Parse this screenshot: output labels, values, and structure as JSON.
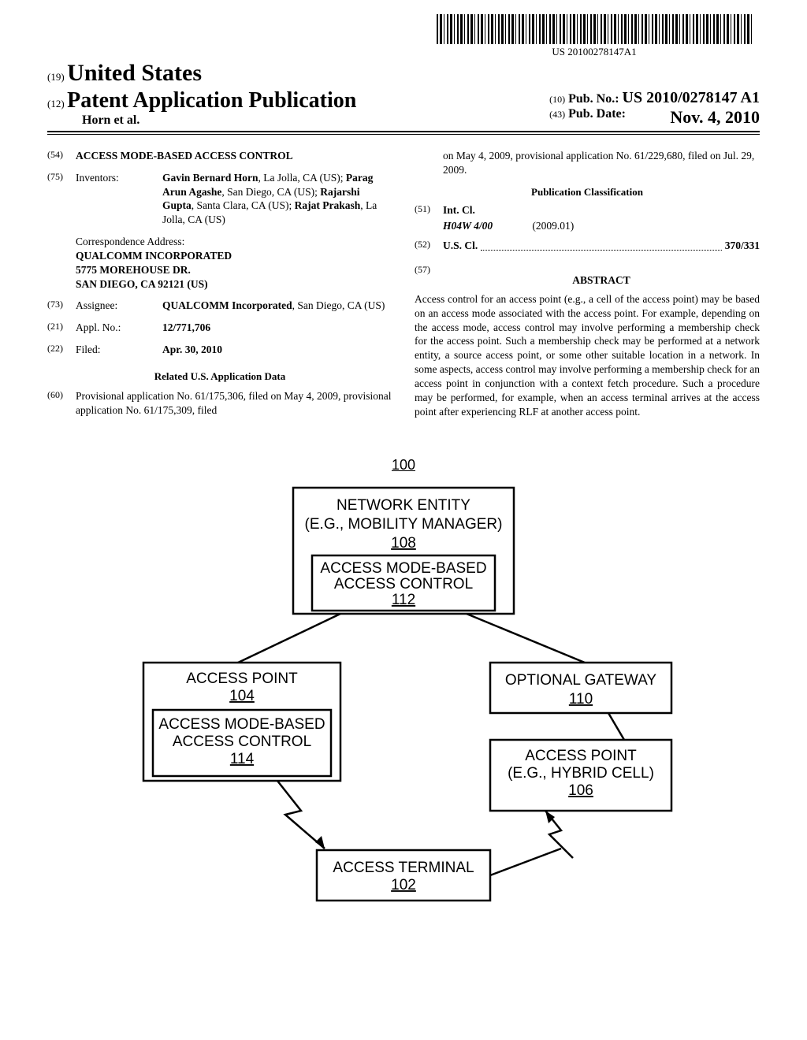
{
  "barcode_text": "US 20100278147A1",
  "country_code": "(19)",
  "country": "United States",
  "doc_type_code": "(12)",
  "doc_type": "Patent Application Publication",
  "authors_line": "Horn et al.",
  "pub_no_code": "(10)",
  "pub_no_label": "Pub. No.:",
  "pub_no": "US 2010/0278147 A1",
  "pub_date_code": "(43)",
  "pub_date_label": "Pub. Date:",
  "pub_date": "Nov. 4, 2010",
  "left": {
    "title_code": "(54)",
    "title": "ACCESS MODE-BASED ACCESS CONTROL",
    "inventors_code": "(75)",
    "inventors_label": "Inventors:",
    "inventors": "Gavin Bernard Horn, La Jolla, CA (US); Parag Arun Agashe, San Diego, CA (US); Rajarshi Gupta, Santa Clara, CA (US); Rajat Prakash, La Jolla, CA (US)",
    "correspondence_label": "Correspondence Address:",
    "correspondence": "QUALCOMM INCORPORATED\n5775 MOREHOUSE DR.\nSAN DIEGO, CA 92121 (US)",
    "assignee_code": "(73)",
    "assignee_label": "Assignee:",
    "assignee": "QUALCOMM Incorporated, San Diego, CA (US)",
    "applno_code": "(21)",
    "applno_label": "Appl. No.:",
    "applno": "12/771,706",
    "filed_code": "(22)",
    "filed_label": "Filed:",
    "filed": "Apr. 30, 2010",
    "related_head": "Related U.S. Application Data",
    "prov_code": "(60)",
    "prov": "Provisional application No. 61/175,306, filed on May 4, 2009, provisional application No. 61/175,309, filed"
  },
  "right": {
    "prov_cont": "on May 4, 2009, provisional application No. 61/229,680, filed on Jul. 29, 2009.",
    "class_head": "Publication Classification",
    "intcl_code": "(51)",
    "intcl_label": "Int. Cl.",
    "intcl_class": "H04W 4/00",
    "intcl_date": "(2009.01)",
    "uscl_code": "(52)",
    "uscl_label": "U.S. Cl.",
    "uscl_val": "370/331",
    "abstract_code": "(57)",
    "abstract_head": "ABSTRACT",
    "abstract": "Access control for an access point (e.g., a cell of the access point) may be based on an access mode associated with the access point. For example, depending on the access mode, access control may involve performing a membership check for the access point. Such a membership check may be performed at a network entity, a source access point, or some other suitable location in a network. In some aspects, access control may involve performing a membership check for an access point in conjunction with a context fetch procedure. Such a procedure may be performed, for example, when an access terminal arrives at the access point after experiencing RLF at another access point."
  },
  "figure": {
    "ref": "100",
    "network_entity": "NETWORK ENTITY",
    "network_entity_sub": "(E.G., MOBILITY MANAGER)",
    "network_entity_ref": "108",
    "amac": "ACCESS MODE-BASED",
    "amac2": "ACCESS CONTROL",
    "amac_ref_112": "112",
    "ap_left": "ACCESS POINT",
    "ap_left_ref": "104",
    "amac_ref_114": "114",
    "gateway": "OPTIONAL GATEWAY",
    "gateway_ref": "110",
    "ap_right": "ACCESS POINT",
    "ap_right_sub": "(E.G., HYBRID CELL)",
    "ap_right_ref": "106",
    "terminal": "ACCESS TERMINAL",
    "terminal_ref": "102"
  }
}
